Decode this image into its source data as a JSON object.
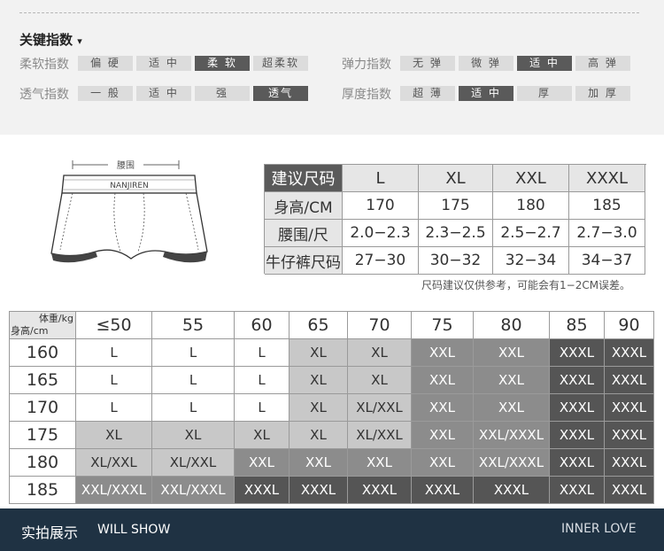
{
  "key_section": {
    "title": "关键指数",
    "caret": "▾",
    "rows": [
      {
        "label": "柔软指数",
        "options": [
          "偏 硬",
          "适 中",
          "柔 软",
          "超柔软"
        ],
        "selected": 2
      },
      {
        "label": "弹力指数",
        "options": [
          "无 弹",
          "微 弹",
          "适 中",
          "高 弹"
        ],
        "selected": 2
      },
      {
        "label": "透气指数",
        "options": [
          "一 般",
          "适 中",
          "强",
          "透气"
        ],
        "selected": 3
      },
      {
        "label": "厚度指数",
        "options": [
          "超 薄",
          "适 中",
          "厚",
          "加 厚"
        ],
        "selected": 1
      }
    ]
  },
  "diagram": {
    "waist_label": "腰围",
    "brand": "NANJIREN"
  },
  "size_table": {
    "headers": [
      "建议尺码",
      "L",
      "XL",
      "XXL",
      "XXXL"
    ],
    "rows": [
      [
        "身高/CM",
        "170",
        "175",
        "180",
        "185"
      ],
      [
        "腰围/尺",
        "2.0−2.3",
        "2.3−2.5",
        "2.5−2.7",
        "2.7−3.0"
      ],
      [
        "牛仔裤尺码",
        "27−30",
        "30−32",
        "32−34",
        "34−37"
      ]
    ],
    "note": "尺码建议仅供参考，可能会有1−2CM误差。"
  },
  "weight_grid": {
    "corner_top": "体重/kg",
    "corner_bottom": "身高/cm",
    "weights": [
      "≤50",
      "55",
      "60",
      "65",
      "70",
      "75",
      "80",
      "85",
      "90"
    ],
    "rows": [
      {
        "height": "160",
        "sizes": [
          "L",
          "L",
          "L",
          "XL",
          "XL",
          "XXL",
          "XXL",
          "XXXL",
          "XXXL"
        ]
      },
      {
        "height": "165",
        "sizes": [
          "L",
          "L",
          "L",
          "XL",
          "XL",
          "XXL",
          "XXL",
          "XXXL",
          "XXXL"
        ]
      },
      {
        "height": "170",
        "sizes": [
          "L",
          "L",
          "L",
          "XL",
          "XL/XXL",
          "XXL",
          "XXL",
          "XXXL",
          "XXXL"
        ]
      },
      {
        "height": "175",
        "sizes": [
          "XL",
          "XL",
          "XL",
          "XL",
          "XL/XXL",
          "XXL",
          "XXL/XXXL",
          "XXXL",
          "XXXL"
        ]
      },
      {
        "height": "180",
        "sizes": [
          "XL/XXL",
          "XL/XXL",
          "XXL",
          "XXL",
          "XXL",
          "XXL",
          "XXL/XXXL",
          "XXXL",
          "XXXL"
        ]
      },
      {
        "height": "185",
        "sizes": [
          "XXL/XXXL",
          "XXL/XXXL",
          "XXXL",
          "XXXL",
          "XXXL",
          "XXXL",
          "XXXL",
          "XXXL",
          "XXXL"
        ]
      }
    ],
    "colors": {
      "L": "#ffffff",
      "XL": "#c8c8c8",
      "XXL": "#8c8c8c",
      "XXXL": "#555555"
    }
  },
  "footer": {
    "title_cn": "实拍展示",
    "title_en": "WILL SHOW",
    "right": "INNER LOVE"
  }
}
